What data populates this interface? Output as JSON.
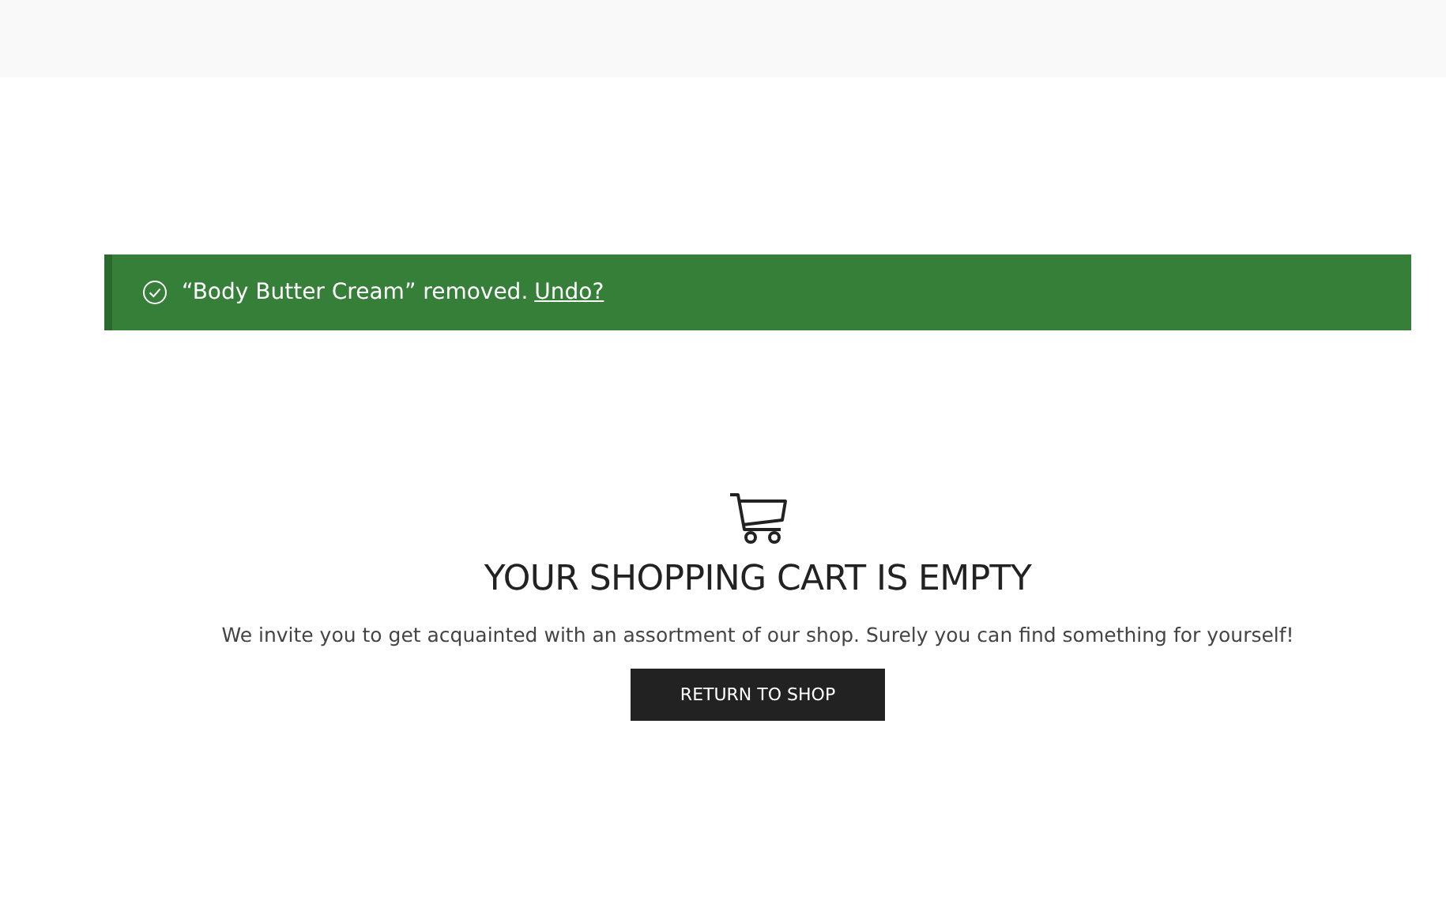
{
  "notice": {
    "message": "“Body Butter Cream” removed.",
    "link": "Undo?"
  },
  "empty_cart": {
    "title": "YOUR SHOPPING CART IS EMPTY",
    "text": "We invite you to get acquainted with an assortment of our shop. Surely you can find something for yourself!",
    "button": "RETURN TO SHOP"
  }
}
